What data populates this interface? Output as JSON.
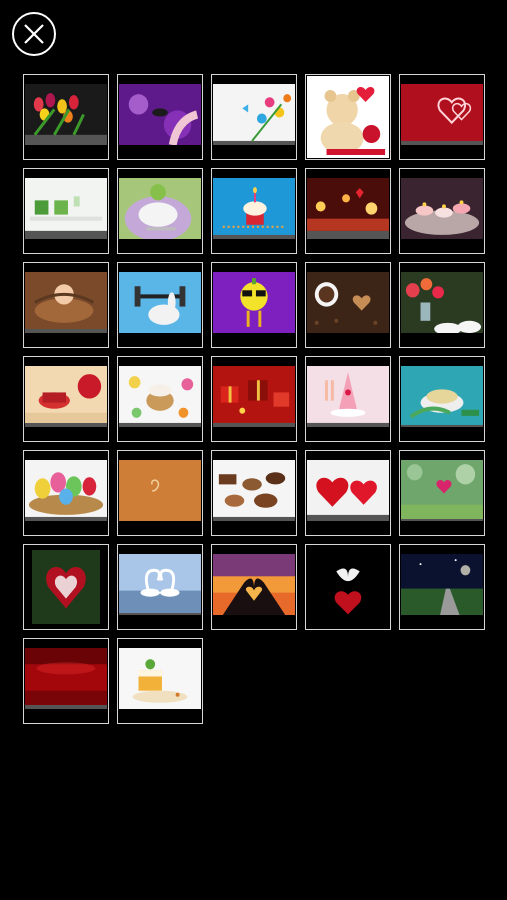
{
  "header": {
    "close_icon": "close-circle-icon"
  },
  "wallpapers": [
    {
      "name": "wallpaper-tulips",
      "theme": "tulips"
    },
    {
      "name": "wallpaper-purple-hands",
      "theme": "purple-hands"
    },
    {
      "name": "wallpaper-flowers-butterflies",
      "theme": "flowers-butterflies"
    },
    {
      "name": "wallpaper-teddy-bear",
      "theme": "teddy-bear"
    },
    {
      "name": "wallpaper-red-hearts",
      "theme": "red-hearts"
    },
    {
      "name": "wallpaper-green-candles",
      "theme": "green-candles"
    },
    {
      "name": "wallpaper-table-setting",
      "theme": "table-setting"
    },
    {
      "name": "wallpaper-birthday-cupcake",
      "theme": "birthday-cupcake"
    },
    {
      "name": "wallpaper-candles-table",
      "theme": "candles-table"
    },
    {
      "name": "wallpaper-floating-candles",
      "theme": "floating-candles"
    },
    {
      "name": "wallpaper-baby-basket",
      "theme": "baby-basket"
    },
    {
      "name": "wallpaper-rabbit-dumbbell",
      "theme": "rabbit-dumbbell"
    },
    {
      "name": "wallpaper-lemon-sunglasses",
      "theme": "lemon-sunglasses"
    },
    {
      "name": "wallpaper-coffee-heart",
      "theme": "coffee-heart"
    },
    {
      "name": "wallpaper-flowers-tea",
      "theme": "flowers-tea"
    },
    {
      "name": "wallpaper-tea-apples",
      "theme": "tea-apples"
    },
    {
      "name": "wallpaper-easter-cake",
      "theme": "easter-cake"
    },
    {
      "name": "wallpaper-christmas-gifts",
      "theme": "christmas-gifts"
    },
    {
      "name": "wallpaper-pink-cake",
      "theme": "pink-cake"
    },
    {
      "name": "wallpaper-teacup",
      "theme": "teacup"
    },
    {
      "name": "wallpaper-easter-eggs",
      "theme": "easter-eggs"
    },
    {
      "name": "wallpaper-orange-texture",
      "theme": "orange-texture"
    },
    {
      "name": "wallpaper-chocolates",
      "theme": "chocolates"
    },
    {
      "name": "wallpaper-red-hearts-snow",
      "theme": "red-hearts-snow"
    },
    {
      "name": "wallpaper-green-bokeh-heart",
      "theme": "green-bokeh-heart"
    },
    {
      "name": "wallpaper-heart-frame",
      "theme": "heart-frame"
    },
    {
      "name": "wallpaper-swans",
      "theme": "swans"
    },
    {
      "name": "wallpaper-sunset-hands-heart",
      "theme": "sunset-hands-heart"
    },
    {
      "name": "wallpaper-dove-heart",
      "theme": "dove-heart"
    },
    {
      "name": "wallpaper-night-road",
      "theme": "night-road"
    },
    {
      "name": "wallpaper-red-stage",
      "theme": "red-stage"
    },
    {
      "name": "wallpaper-dessert",
      "theme": "dessert"
    }
  ],
  "colors": {
    "background": "#000000",
    "tile_border": "#d6d6d6"
  }
}
